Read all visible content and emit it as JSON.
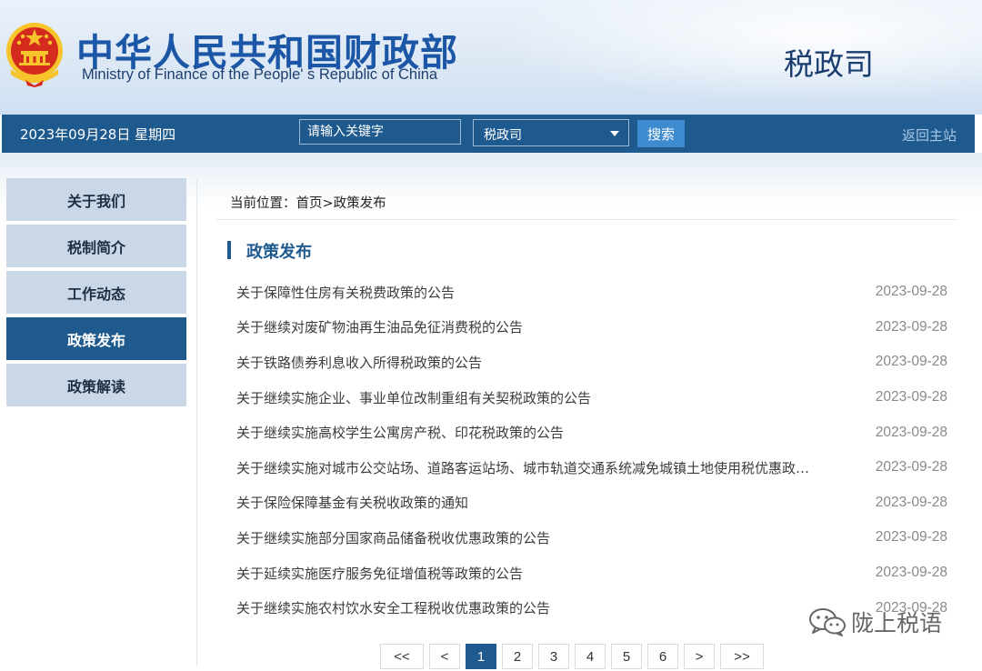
{
  "header": {
    "site_title_cn": "中华人民共和国财政部",
    "site_title_en": "Ministry of Finance of the People' s Republic of China",
    "department": "税政司"
  },
  "navbar": {
    "date": "2023年09月28日  星期四",
    "search_placeholder": "请输入关键字",
    "select_value": "税政司",
    "search_button": "搜索",
    "back_home": "返回主站"
  },
  "sidebar": {
    "items": [
      {
        "label": "关于我们"
      },
      {
        "label": "税制简介"
      },
      {
        "label": "工作动态"
      },
      {
        "label": "政策发布",
        "active": true
      },
      {
        "label": "政策解读"
      }
    ]
  },
  "breadcrumb": {
    "prefix": "当前位置：",
    "home": "首页",
    "separator": ">",
    "current": "政策发布"
  },
  "section": {
    "title": "政策发布"
  },
  "news": [
    {
      "title": "关于保障性住房有关税费政策的公告",
      "date": "2023-09-28"
    },
    {
      "title": "关于继续对废矿物油再生油品免征消费税的公告",
      "date": "2023-09-28"
    },
    {
      "title": "关于铁路债券利息收入所得税政策的公告",
      "date": "2023-09-28"
    },
    {
      "title": "关于继续实施企业、事业单位改制重组有关契税政策的公告",
      "date": "2023-09-28"
    },
    {
      "title": "关于继续实施高校学生公寓房产税、印花税政策的公告",
      "date": "2023-09-28"
    },
    {
      "title": "关于继续实施对城市公交站场、道路客运站场、城市轨道交通系统减免城镇土地使用税优惠政…",
      "date": "2023-09-28"
    },
    {
      "title": "关于保险保障基金有关税收政策的通知",
      "date": "2023-09-28"
    },
    {
      "title": "关于继续实施部分国家商品储备税收优惠政策的公告",
      "date": "2023-09-28"
    },
    {
      "title": "关于延续实施医疗服务免征增值税等政策的公告",
      "date": "2023-09-28"
    },
    {
      "title": "关于继续实施农村饮水安全工程税收优惠政策的公告",
      "date": "2023-09-28"
    }
  ],
  "pagination": {
    "first": "<<",
    "prev": "<",
    "pages": [
      "1",
      "2",
      "3",
      "4",
      "5",
      "6"
    ],
    "current": "1",
    "next": ">",
    "last": ">>"
  },
  "watermark": {
    "text": "陇上税语",
    "icon": "wechat-icon"
  },
  "colors": {
    "brand": "#1f5a8e",
    "title_blue": "#1b57a6",
    "accent": "#3e8bd0",
    "emblem_red": "#d52b1e",
    "emblem_gold": "#f7c52b"
  }
}
